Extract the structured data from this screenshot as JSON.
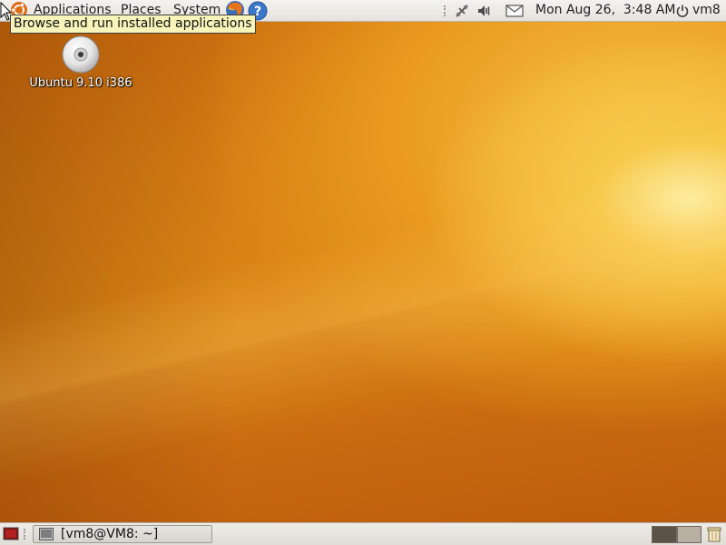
{
  "top_panel": {
    "menus": {
      "applications": "Applications",
      "places": "Places",
      "system": "System"
    },
    "launchers": [
      "firefox-icon",
      "help-icon"
    ],
    "tray_icons": [
      "network-icon",
      "volume-icon",
      "mail-icon"
    ],
    "clock": "Mon Aug 26,  3:48 AM",
    "user": "vm8"
  },
  "tooltip": {
    "text": "Browse and run installed applications"
  },
  "desktop": {
    "icons": [
      {
        "label": "Ubuntu 9.10 i386",
        "icon": "cd-drive-icon"
      }
    ]
  },
  "bottom_panel": {
    "show_desktop_icon": "show-desktop-icon",
    "tasks": [
      {
        "label": "[vm8@VM8: ~]",
        "icon": "terminal-icon"
      }
    ],
    "workspaces": 2,
    "trash_icon": "trash-icon"
  },
  "colors": {
    "panel": "#e6e3de",
    "tooltip_bg": "#f7f3b9",
    "wallpaper_dark": "#b95a0c",
    "wallpaper_light": "#fdf1a8"
  }
}
